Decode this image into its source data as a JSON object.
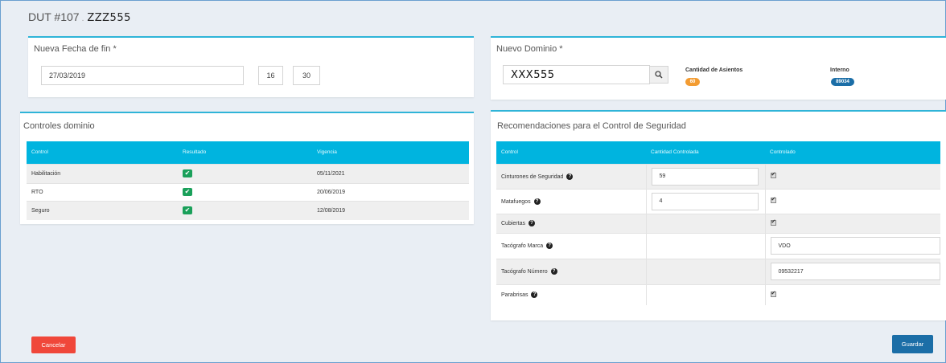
{
  "header": {
    "dut": "DUT #107",
    "separator": ".",
    "plate": "ZZZ555"
  },
  "fecha": {
    "title": "Nueva Fecha de fin *",
    "date_value": "27/03/2019",
    "hour_value": "16",
    "minute_value": "30"
  },
  "dominio": {
    "title": "Nuevo Dominio *",
    "input_value": "XXX555",
    "search_icon": "search-icon",
    "asientos_label": "Cantidad de Asientos",
    "asientos_value": "60",
    "asientos_color": "#f39c32",
    "interno_label": "Interno",
    "interno_value": "89034",
    "interno_color": "#1b6ea7"
  },
  "controles": {
    "title": "Controles dominio",
    "headers": [
      "Control",
      "Resultado",
      "Vigencia"
    ],
    "rows": [
      {
        "control": "Habilitación",
        "resultado": "✔",
        "vigencia": "05/11/2021"
      },
      {
        "control": "RTO",
        "resultado": "✔",
        "vigencia": "20/06/2019"
      },
      {
        "control": "Seguro",
        "resultado": "✔",
        "vigencia": "12/08/2019"
      }
    ]
  },
  "reco": {
    "title": "Recomendaciones para el Control de Seguridad",
    "headers": [
      "Control",
      "Cantidad Controlada",
      "Controlado"
    ],
    "rows": [
      {
        "control": "Cinturones de Seguridad",
        "cantidad": "59",
        "controlado": "checked"
      },
      {
        "control": "Matafuegos",
        "cantidad": "4",
        "controlado": "checked"
      },
      {
        "control": "Cubiertas",
        "cantidad": "",
        "controlado": "checked"
      },
      {
        "control": "Tacógrafo Marca",
        "cantidad": "",
        "controlado_text": "VDO"
      },
      {
        "control": "Tacógrafo Número",
        "cantidad": "",
        "controlado_text": "09532217"
      },
      {
        "control": "Parabrisas",
        "cantidad": "",
        "controlado": "checked"
      }
    ]
  },
  "buttons": {
    "cancelar": "Cancelar",
    "guardar": "Guardar"
  },
  "colors": {
    "accent": "#2fb4d8",
    "table_header": "#00b4df",
    "cancel": "#f0473a",
    "save": "#1b6ea7",
    "ok": "#1aa05a"
  }
}
